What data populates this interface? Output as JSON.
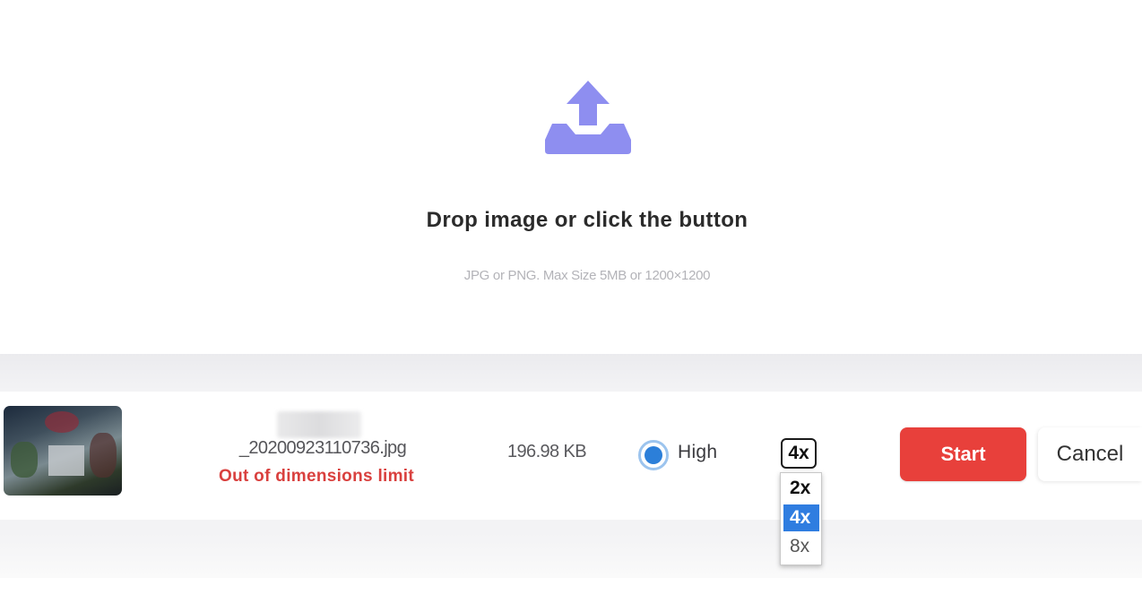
{
  "dropzone": {
    "icon": "upload-tray-icon",
    "title": "Drop image or click the button",
    "hint": "JPG or PNG. Max Size 5MB or 1200×1200"
  },
  "file": {
    "name": "_20200923110736.jpg",
    "error": "Out of dimensions limit",
    "size": "196.98 KB",
    "quality_label": "High",
    "quality_selected": true
  },
  "scale": {
    "selected": "4x",
    "options": [
      "2x",
      "4x",
      "8x"
    ],
    "highlighted": "4x"
  },
  "actions": {
    "start_label": "Start",
    "cancel_label": "Cancel"
  },
  "colors": {
    "accent_purple": "#8e8ef0",
    "start_red": "#e8403b",
    "error_red": "#d9403e",
    "radio_blue": "#2c7fd9",
    "option_highlight": "#2f7de0"
  }
}
